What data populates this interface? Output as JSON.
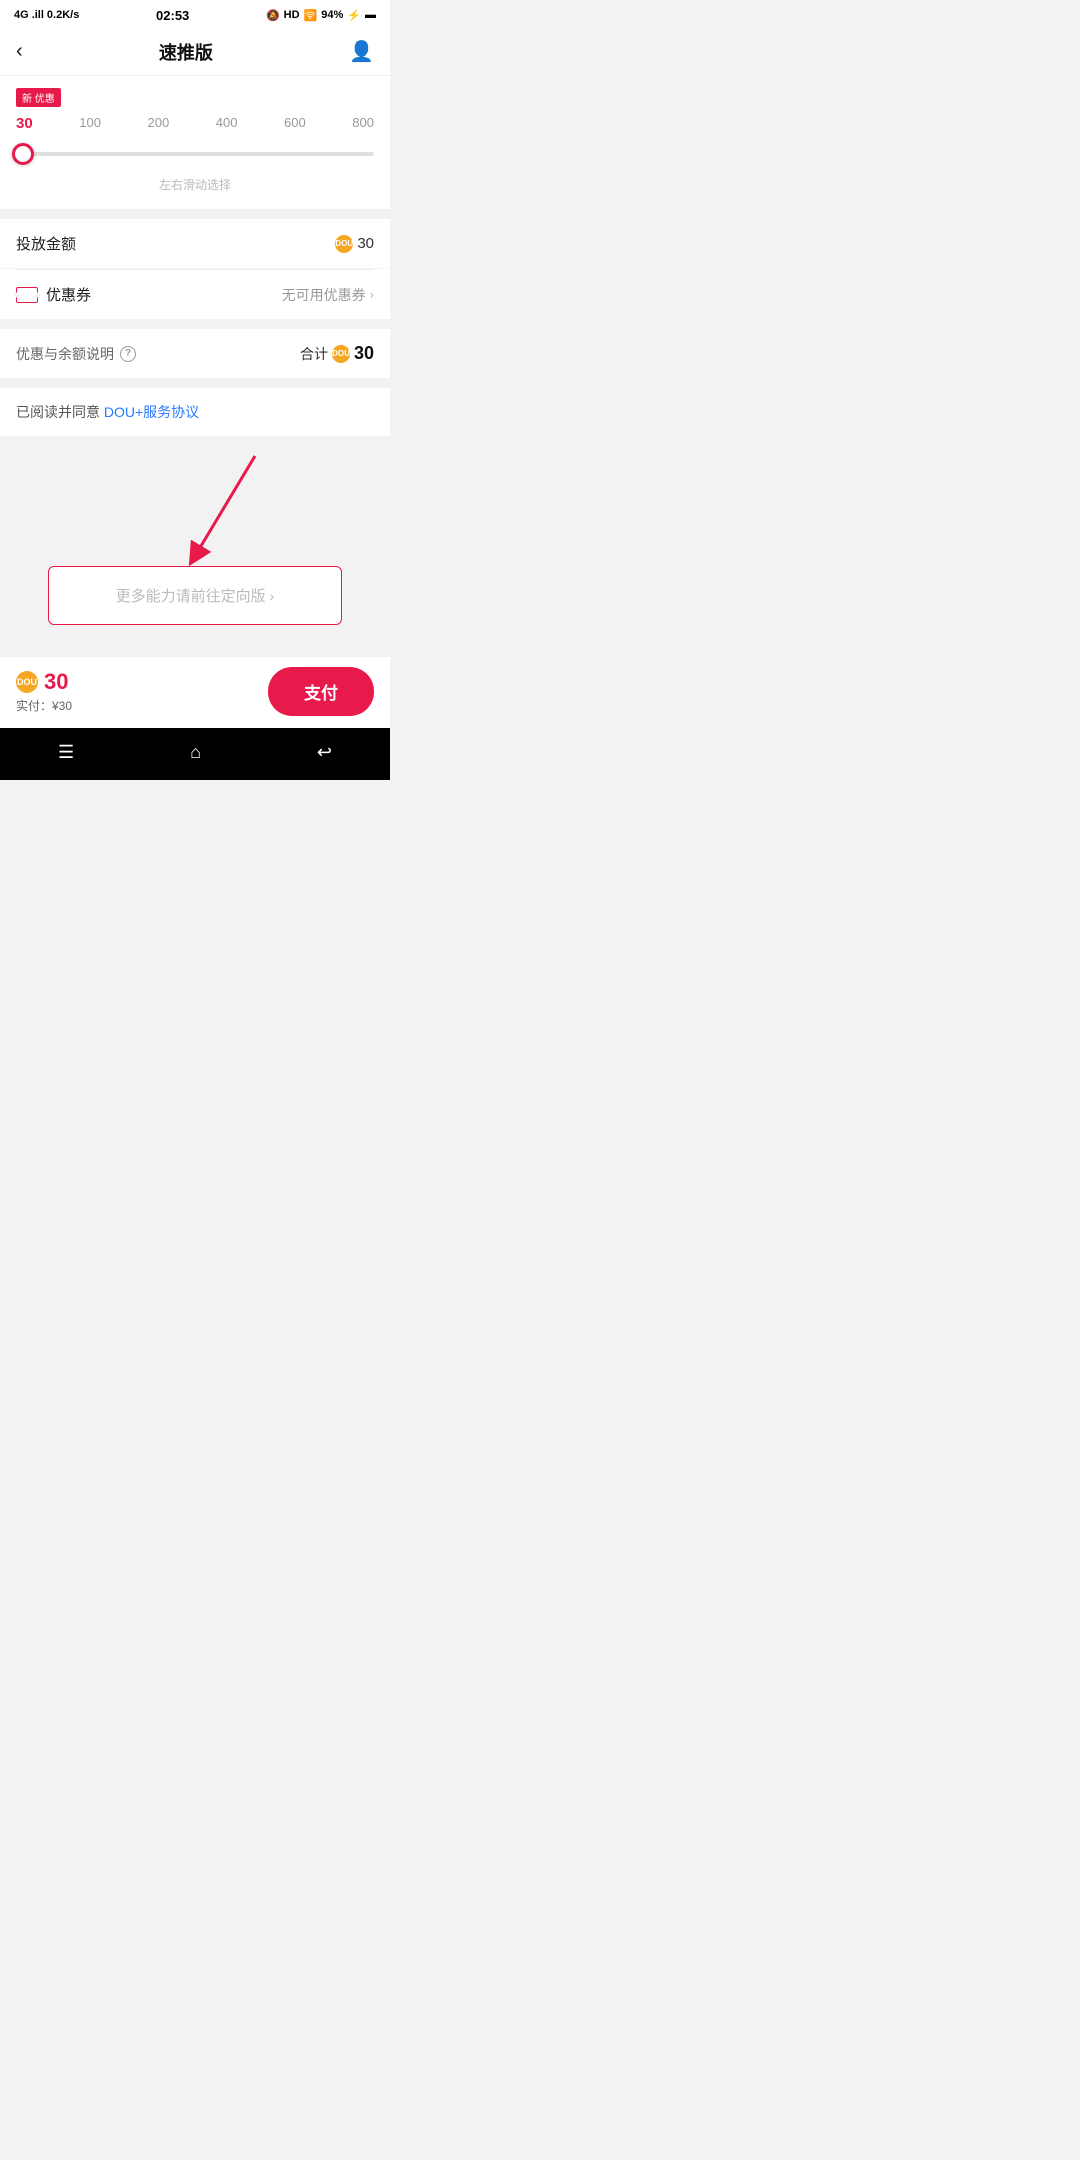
{
  "statusBar": {
    "left": "4G .ill 0.2K/s",
    "center": "02:53",
    "right": "HD  94% ⚡"
  },
  "header": {
    "backLabel": "‹",
    "title": "速推版",
    "userIcon": "👤"
  },
  "slider": {
    "tag": "新 优惠",
    "values": [
      "30",
      "100",
      "200",
      "400",
      "600",
      "800"
    ],
    "hint": "左右滑动选择"
  },
  "amountRow": {
    "label": "投放金额",
    "value": "30"
  },
  "couponRow": {
    "label": "优惠券",
    "value": "无可用优惠券",
    "chevron": "›"
  },
  "totalRow": {
    "discountLabel": "优惠与余额说明",
    "totalLabel": "合计",
    "value": "30"
  },
  "agreement": {
    "prefix": "已阅读并同意 ",
    "link": "DOU+服务协议"
  },
  "moreBtn": {
    "text": "更多能力请前往定向版",
    "chevron": "›"
  },
  "bottomBar": {
    "price": "30",
    "actualLabel": "实付：¥30",
    "payLabel": "支付"
  },
  "navBar": {
    "menu": "☰",
    "home": "⌂",
    "back": "↩"
  }
}
